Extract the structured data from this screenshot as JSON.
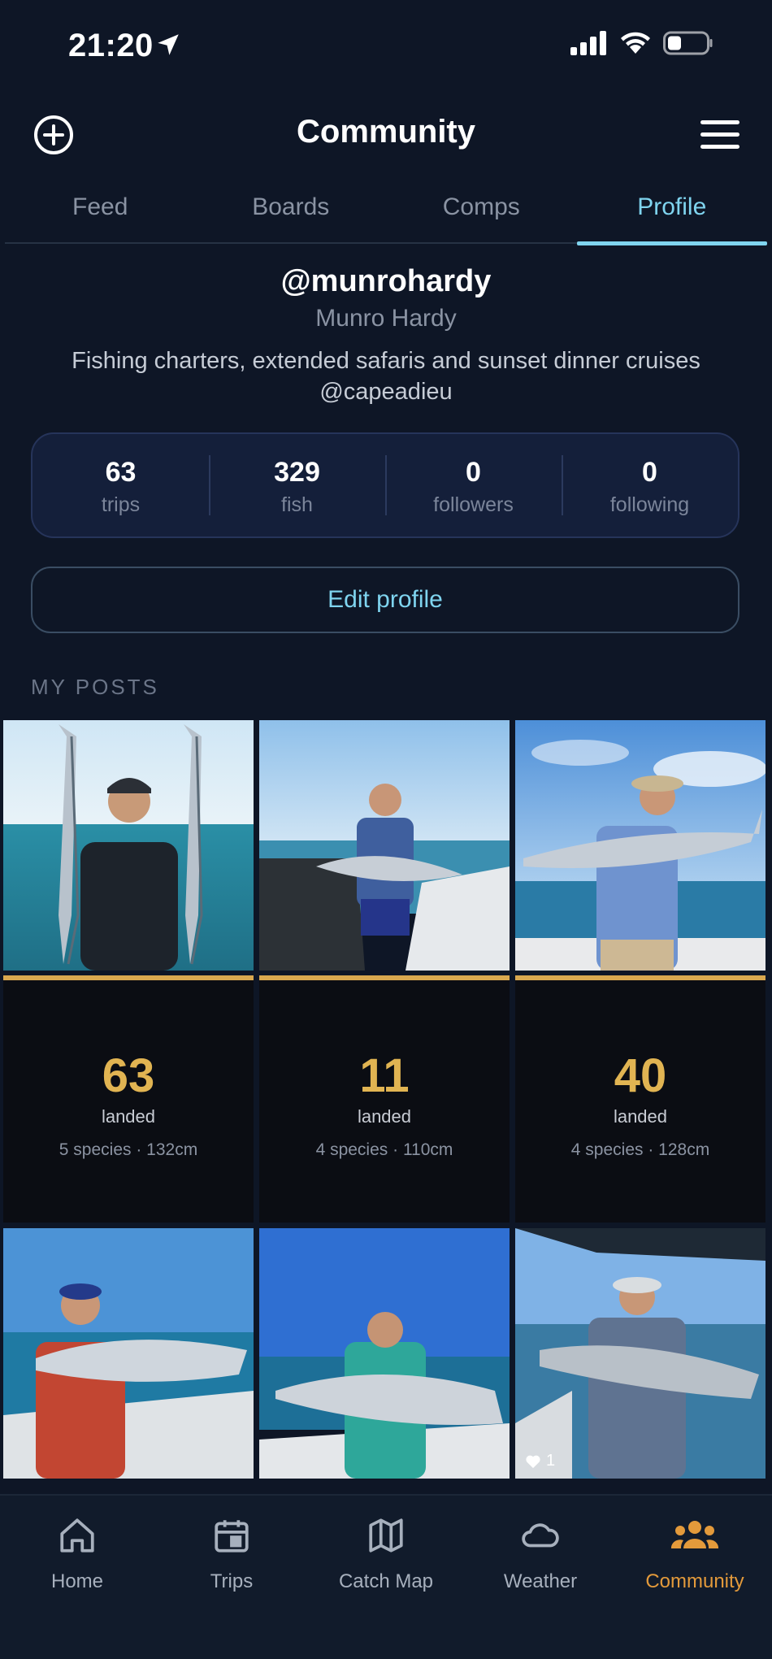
{
  "status": {
    "time": "21:20"
  },
  "header": {
    "title": "Community"
  },
  "tabs": [
    {
      "label": "Feed",
      "active": false
    },
    {
      "label": "Boards",
      "active": false
    },
    {
      "label": "Comps",
      "active": false
    },
    {
      "label": "Profile",
      "active": true
    }
  ],
  "profile": {
    "username": "@munrohardy",
    "name": "Munro Hardy",
    "bio": "Fishing charters, extended safaris and sunset dinner cruises @capeadieu",
    "stats": [
      {
        "value": "63",
        "label": "trips"
      },
      {
        "value": "329",
        "label": "fish"
      },
      {
        "value": "0",
        "label": "followers"
      },
      {
        "value": "0",
        "label": "following"
      }
    ],
    "edit_label": "Edit profile"
  },
  "posts_label": "MY POSTS",
  "trip_stats": [
    {
      "landed": "63",
      "landed_label": "landed",
      "detail": "5 species · 132cm"
    },
    {
      "landed": "11",
      "landed_label": "landed",
      "detail": "4 species · 110cm"
    },
    {
      "landed": "40",
      "landed_label": "landed",
      "detail": "4 species · 128cm"
    }
  ],
  "last_post_likes": "1",
  "nav": [
    {
      "label": "Home",
      "icon": "home-icon",
      "active": false
    },
    {
      "label": "Trips",
      "icon": "calendar-icon",
      "active": false
    },
    {
      "label": "Catch Map",
      "icon": "map-icon",
      "active": false
    },
    {
      "label": "Weather",
      "icon": "cloud-icon",
      "active": false
    },
    {
      "label": "Community",
      "icon": "people-icon",
      "active": true
    }
  ],
  "colors": {
    "accent": "#7fd4ef",
    "gold": "#e1b452",
    "nav_active": "#e39a3b",
    "background": "#0e1626"
  }
}
